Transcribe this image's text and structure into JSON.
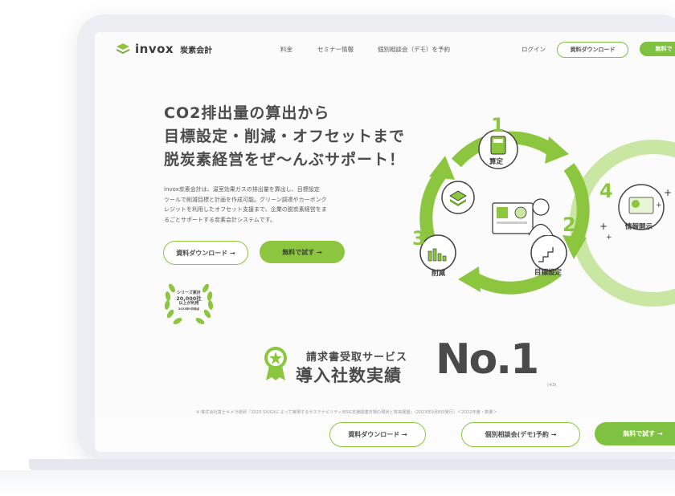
{
  "header": {
    "logo_text": "invox",
    "logo_sub": "炭素会計",
    "nav": [
      "料金",
      "セミナー情報",
      "個別相談会（デモ）を予約"
    ],
    "login": "ログイン",
    "download": "資料ダウンロード",
    "free": "無料で"
  },
  "hero": {
    "headline": [
      "CO2排出量の算出から",
      "目標設定・削減・オフセットまで",
      "脱炭素経営をぜ〜んぶサポート！"
    ],
    "description": [
      "invox炭素会計は、温室効果ガスの排出量を算出し、目標設定",
      "ツールで削減目標と計画を作成可能。グリーン調達やカーボンク",
      "レジットを利用したオフセット支援まで、企業の脱炭素経営をま",
      "るごとサポートする炭素会計システムです。"
    ],
    "cta_download": "資料ダウンロード →",
    "cta_free": "無料で試す →",
    "badge": [
      "シリーズ累計",
      "20,000社",
      "以上が利用",
      "2023年9月時点"
    ]
  },
  "illustration": {
    "steps": [
      {
        "num": "1",
        "label": "算定"
      },
      {
        "num": "2",
        "label": "目標設定"
      },
      {
        "num": "3",
        "label": "削減"
      },
      {
        "num": "4",
        "label": "情報開示"
      }
    ]
  },
  "award": {
    "line1": "請求書受取サービス",
    "line2": "導入社数実績",
    "no1": "No.1",
    "note": "(※3)",
    "footnote": "※ 株式会社富士キメラ総研「2023 SX/GXによって実現するサステナビリティ/ESG支援関連市場の現状と将来展望」（2023年9月8日発行）＜2022年度・数量＞"
  },
  "sticky": {
    "download": "資料ダウンロード →",
    "demo": "個別相談会(デモ)予約 →",
    "free": "無料で試す →"
  },
  "colors": {
    "accent": "#8cc63f",
    "accent_dark": "#7fc241",
    "text": "#4a4a4a"
  }
}
